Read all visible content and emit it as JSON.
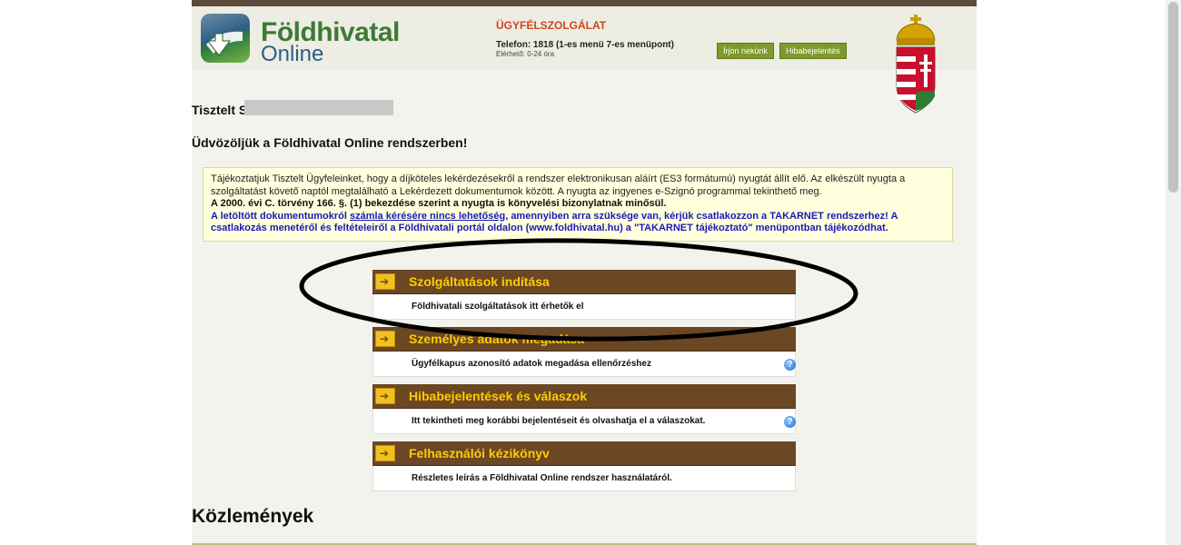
{
  "header": {
    "logo_title": "Földhivatal",
    "logo_sub": "Online",
    "service_title": "ÜGYFÉLSZOLGÁLAT",
    "phone": "Telefon: 1818 (1-es menü 7-es menüpont)",
    "hours": "Elérhető: 0-24 óra",
    "btn_write": "Írjon nekünk",
    "btn_report": "Hibabejelentés"
  },
  "greeting": "Tisztelt S",
  "welcome": "Üdvözöljük a Földhivatal Online rendszerben!",
  "notice": {
    "line1": "Tájékoztatjuk Tisztelt Ügyfeleinket, hogy a díjköteles lekérdezésekről a rendszer elektronikusan aláírt (ES3 formátumú) nyugtát állít elő. Az elkészült nyugta a szolgáltatást követő naptól megtalálható a Lekérdezett dokumentumok között. A nyugta az ingyenes e-Szignó programmal tekinthető meg.",
    "line2": "A 2000. évi C. törvény 166. §. (1) bekezdése szerint a nyugta is könyvelési bizonylatnak minősül.",
    "line3_a": "A letöltött dokumentumokról ",
    "line3_link": "számla kérésére nincs lehetőség",
    "line3_b": ", amennyiben arra szüksége van, kérjük csatlakozzon a TAKARNET rendszerhez! A csatlakozás menetéről és feltételeiről a Földhivatali portál oldalon (www.foldhivatal.hu) a \"TAKARNET tájékoztató\" menüpontban tájékozódhat."
  },
  "menu": [
    {
      "label": "Szolgáltatások indítása",
      "desc": "Földhivatali szolgáltatások itt érhetők el"
    },
    {
      "label": "Személyes adatok megadása",
      "desc": "Ügyfélkapus azonosító adatok megadása ellenőrzéshez"
    },
    {
      "label": "Hibabejelentések és válaszok",
      "desc": "Itt tekintheti meg korábbi bejelentéseit és olvashatja el a válaszokat."
    },
    {
      "label": "Felhasználói kézikönyv",
      "desc": "Részletes leírás a Földhivatal Online rendszer használatáról."
    }
  ],
  "help_icon": "?",
  "arrow_icon": "➔",
  "announcements_title": "Közlemények"
}
